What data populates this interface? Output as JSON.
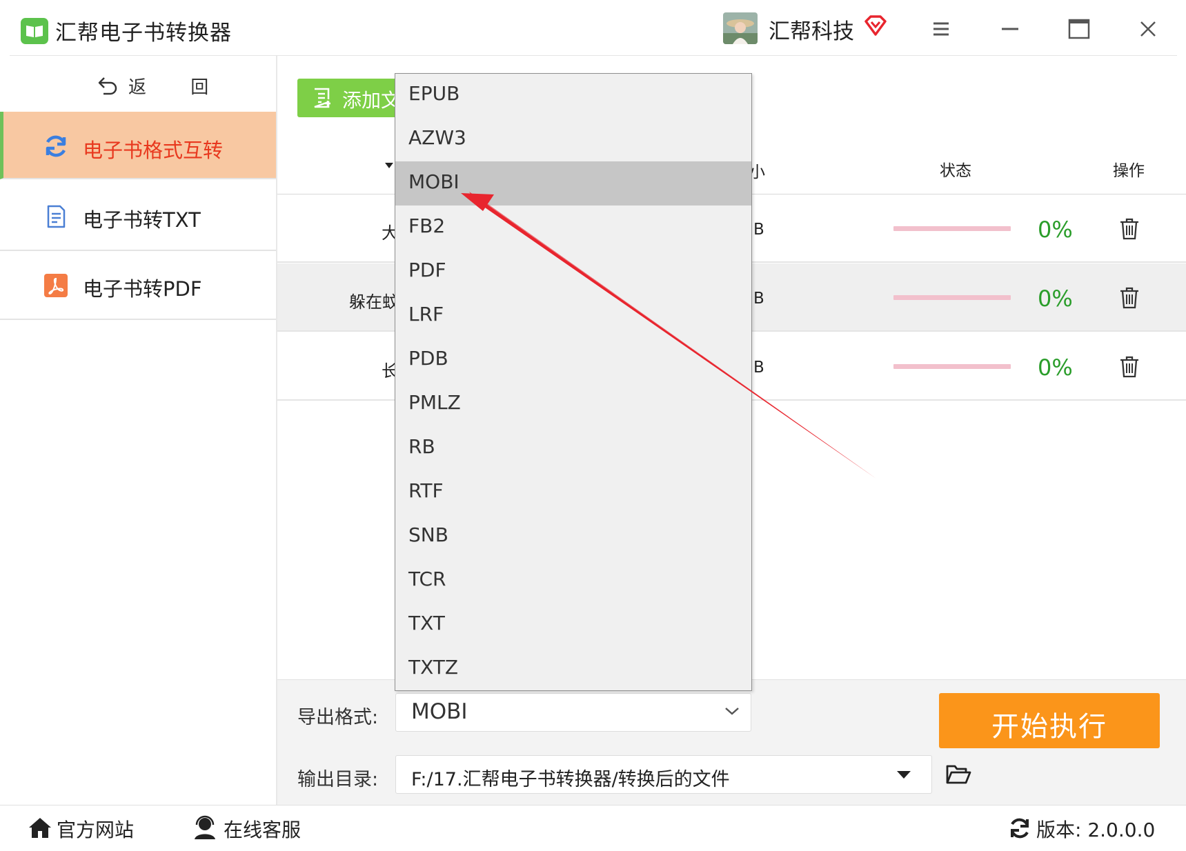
{
  "titlebar": {
    "app_title": "汇帮电子书转换器",
    "brand_name": "汇帮科技",
    "accent_color": "#5cc24c"
  },
  "sidebar": {
    "back_label": "返 回",
    "items": [
      {
        "label": "电子书格式互转",
        "icon": "refresh-icon",
        "active": true
      },
      {
        "label": "电子书转TXT",
        "icon": "document-icon",
        "active": false
      },
      {
        "label": "电子书转PDF",
        "icon": "pdf-icon",
        "active": false
      }
    ],
    "active_bg": "#f8c8a2",
    "active_text_color": "#e8381e"
  },
  "toolbar": {
    "add_file_label": "添加文"
  },
  "table": {
    "headers": {
      "size": "小",
      "status": "状态",
      "action": "操作"
    },
    "rows": [
      {
        "name": "大",
        "size": "B",
        "progress": 0,
        "percent": "0%"
      },
      {
        "name": "躲在蚊",
        "size": "B",
        "progress": 0,
        "percent": "0%"
      },
      {
        "name": "长",
        "size": "B",
        "progress": 0,
        "percent": "0%"
      }
    ]
  },
  "format_dropdown": {
    "options": [
      "EPUB",
      "AZW3",
      "MOBI",
      "FB2",
      "PDF",
      "LRF",
      "PDB",
      "PMLZ",
      "RB",
      "RTF",
      "SNB",
      "TCR",
      "TXT",
      "TXTZ"
    ],
    "highlighted": "MOBI"
  },
  "bottom": {
    "format_label": "导出格式:",
    "format_value": "MOBI",
    "dir_label": "输出目录:",
    "dir_value": "F:/17.汇帮电子书转换器/转换后的文件",
    "start_label": "开始执行",
    "start_color": "#fb951a"
  },
  "footer": {
    "home_label": "官方网站",
    "support_label": "在线客服",
    "version_label": "版本: 2.0.0.0"
  }
}
